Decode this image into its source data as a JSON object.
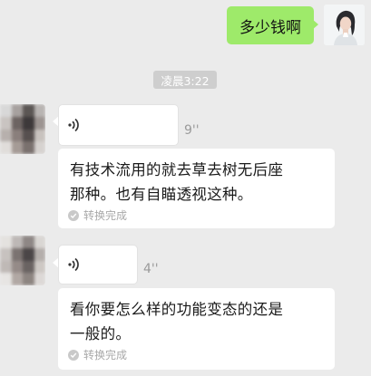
{
  "outgoing": {
    "text": "多少钱啊"
  },
  "timestamp": "凌晨3:22",
  "messages": [
    {
      "voice_duration": "9''",
      "transcript_line1": "有技术流用的就去草去树无后座",
      "transcript_line2": "那种。也有自瞄透视这种。",
      "status": "转换完成"
    },
    {
      "voice_duration": "4''",
      "transcript_line1": "看你要怎么样的功能变态的还是",
      "transcript_line2": "一般的。",
      "status": "转换完成"
    }
  ],
  "icons": {
    "voice": "voice-wave-icon",
    "done": "check-circle-icon"
  },
  "colors": {
    "outgoing_bubble": "#9eea6a",
    "background": "#ebebeb",
    "time_pill": "#cecece"
  }
}
